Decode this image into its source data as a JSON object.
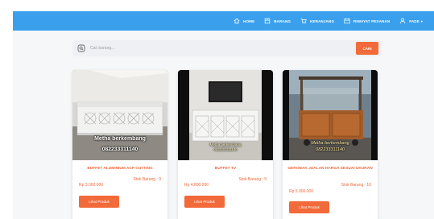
{
  "nav": {
    "home": "HOME",
    "barang": "BARANG",
    "keranjang": "KERANJANG",
    "riwayat": "RIWAYAT PESANAN",
    "user": "FADE"
  },
  "search": {
    "placeholder": "Cari barang...",
    "button_label": "CARI"
  },
  "products": [
    {
      "watermark_line1": "Metha berkembang",
      "watermark_line2": "082233311140",
      "title": "BUFFET ALUMINIUM ACP CUTTING",
      "stock": "Stok Barang : 9",
      "price": "Rp 3.000.000",
      "button": "Lihat Produk"
    },
    {
      "watermark_line1": "Metha berkembang",
      "watermark_line2": "082233311140",
      "title": "BUFFET TV",
      "stock": "Stok Barang : 9",
      "price": "Rp 4.800.000",
      "button": "Lihat Produk"
    },
    {
      "watermark_line1": "Metha berkembang",
      "watermark_line2": "082233311140",
      "title": "GEROBAK JUALAN HARGA SESUAI UKURAN",
      "stock": "Stok Barang : 10",
      "price": "Rp 5.000.000",
      "button": "Lihat Produk"
    }
  ],
  "colors": {
    "navbar": "#3aa0ee",
    "accent": "#f26a3a",
    "page_bg": "#f6f7f9"
  },
  "icons": {
    "home": "home-icon",
    "barang": "box-icon",
    "keranjang": "cart-icon",
    "riwayat": "history-icon",
    "user": "user-icon",
    "search": "search-icon"
  }
}
